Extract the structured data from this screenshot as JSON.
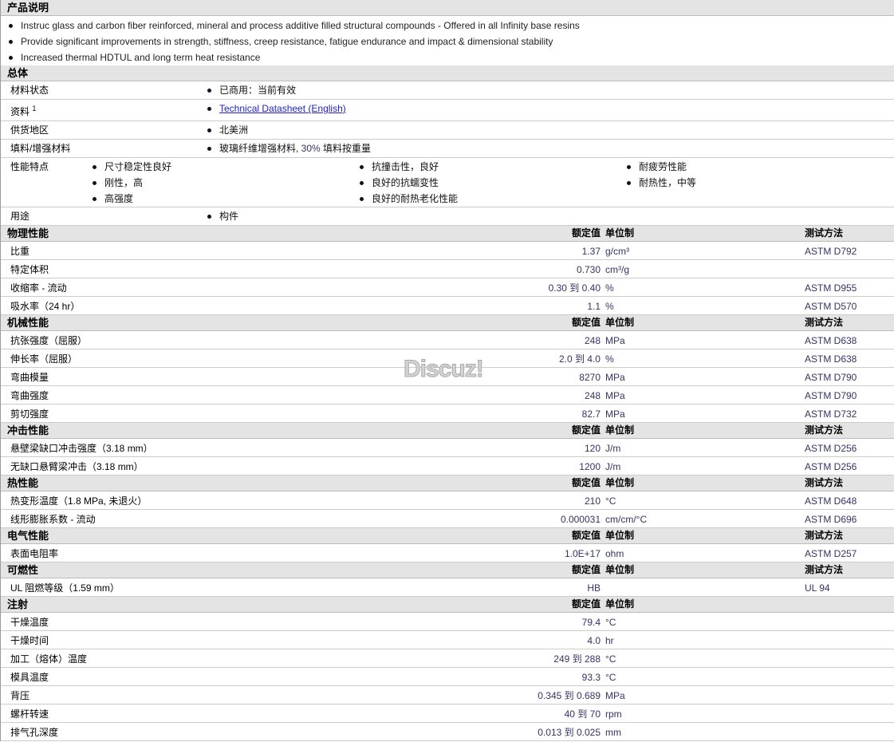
{
  "description": {
    "title": "产品说明",
    "items": [
      "Instruc glass and carbon fiber reinforced, mineral and process additive filled structural compounds - Offered in all Infinity base resins",
      "Provide significant improvements in strength, stiffness, creep resistance, fatigue endurance and impact & dimensional stability",
      "Increased thermal HDTUL and long term heat resistance"
    ]
  },
  "general": {
    "title": "总体",
    "rows": [
      {
        "label": "材料状态",
        "cols": [
          [
            "已商用：当前有效"
          ]
        ]
      },
      {
        "label": "资料",
        "sup": "1",
        "link": "Technical Datasheet (English)"
      },
      {
        "label": "供货地区",
        "cols": [
          [
            "北美洲"
          ]
        ]
      },
      {
        "label": "填料/增强材料",
        "filler": {
          "pre": "玻璃纤维增强材料, ",
          "pct": "30%",
          "post": " 填料按重量"
        }
      },
      {
        "label": "性能特点",
        "cols": [
          [
            "尺寸稳定性良好",
            "刚性，高",
            "高强度"
          ],
          [
            "抗撞击性，良好",
            "良好的抗蠕变性",
            "良好的耐热老化性能"
          ],
          [
            "耐疲劳性能",
            "耐热性，中等"
          ]
        ]
      },
      {
        "label": "用途",
        "cols": [
          [
            "构件"
          ]
        ]
      }
    ]
  },
  "headers": {
    "value": "额定值",
    "unit": "单位制",
    "method": "测试方法"
  },
  "sections": [
    {
      "title": "物理性能",
      "method": true,
      "rows": [
        [
          "比重",
          "1.37",
          "g/cm³",
          "ASTM D792"
        ],
        [
          "特定体积",
          "0.730",
          "cm³/g",
          ""
        ],
        [
          "收缩率 - 流动",
          "0.30 到  0.40",
          "%",
          "ASTM D955"
        ],
        [
          "吸水率（24 hr）",
          "1.1",
          "%",
          "ASTM D570"
        ]
      ]
    },
    {
      "title": "机械性能",
      "method": true,
      "rows": [
        [
          "抗张强度（屈服）",
          "248",
          "MPa",
          "ASTM D638"
        ],
        [
          "伸长率（屈服）",
          "2.0 到  4.0",
          "%",
          "ASTM D638"
        ],
        [
          "弯曲模量",
          "8270",
          "MPa",
          "ASTM D790"
        ],
        [
          "弯曲强度",
          "248",
          "MPa",
          "ASTM D790"
        ],
        [
          "剪切强度",
          "82.7",
          "MPa",
          "ASTM D732"
        ]
      ]
    },
    {
      "title": "冲击性能",
      "method": true,
      "rows": [
        [
          "悬壁梁缺口冲击强度（3.18 mm）",
          "120",
          "J/m",
          "ASTM D256"
        ],
        [
          "无缺口悬臂梁冲击（3.18 mm）",
          "1200",
          "J/m",
          "ASTM D256"
        ]
      ]
    },
    {
      "title": "热性能",
      "method": true,
      "rows": [
        [
          "热变形温度（1.8 MPa, 未退火）",
          "210",
          "°C",
          "ASTM D648"
        ],
        [
          "线形膨胀系数 - 流动",
          "0.000031",
          "cm/cm/°C",
          "ASTM D696"
        ]
      ]
    },
    {
      "title": "电气性能",
      "method": true,
      "rows": [
        [
          "表面电阻率",
          "1.0E+17",
          "ohm",
          "ASTM D257"
        ]
      ]
    },
    {
      "title": "可燃性",
      "method": true,
      "rows": [
        [
          "UL 阻燃等级（1.59 mm）",
          "HB",
          "",
          "UL 94"
        ]
      ]
    },
    {
      "title": "注射",
      "method": false,
      "rows": [
        [
          "干燥温度",
          "79.4",
          "°C",
          ""
        ],
        [
          "干燥时间",
          "4.0",
          "hr",
          ""
        ],
        [
          "加工（熔体）温度",
          "249 到  288",
          "°C",
          ""
        ],
        [
          "模具温度",
          "93.3",
          "°C",
          ""
        ],
        [
          "背压",
          "0.345 到  0.689",
          "MPa",
          ""
        ],
        [
          "螺杆转速",
          "40 到  70",
          "rpm",
          ""
        ],
        [
          "排气孔深度",
          "0.013 到  0.025",
          "mm",
          ""
        ]
      ]
    }
  ],
  "watermark": "Discuz!"
}
